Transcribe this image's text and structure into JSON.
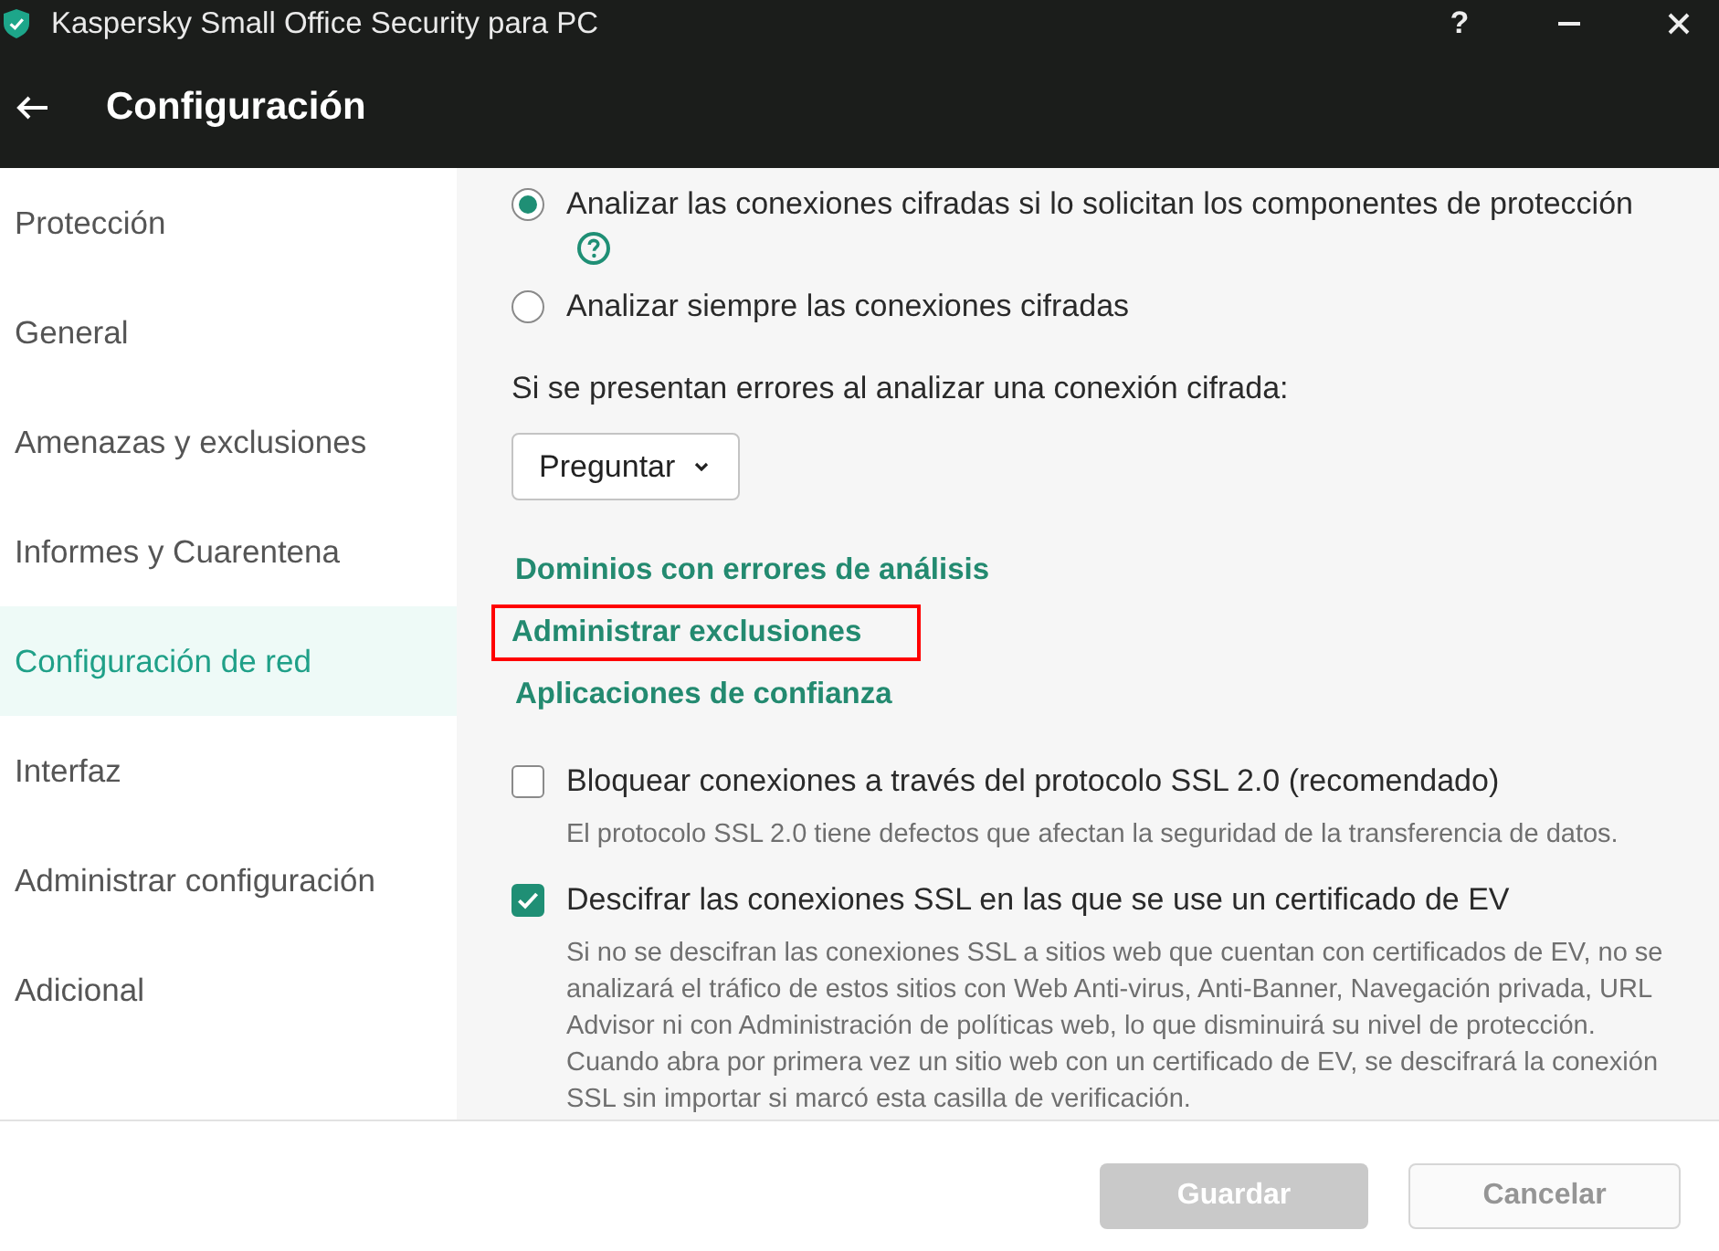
{
  "window": {
    "title": "Kaspersky Small Office Security para PC",
    "help_button": "?"
  },
  "header": {
    "title": "Configuración"
  },
  "sidebar": {
    "items": [
      {
        "label": "Protección",
        "selected": false
      },
      {
        "label": "General",
        "selected": false
      },
      {
        "label": "Amenazas y exclusiones",
        "selected": false
      },
      {
        "label": "Informes y Cuarentena",
        "selected": false
      },
      {
        "label": "Configuración de red",
        "selected": true
      },
      {
        "label": "Interfaz",
        "selected": false
      },
      {
        "label": "Administrar configuración",
        "selected": false
      },
      {
        "label": "Adicional",
        "selected": false
      }
    ]
  },
  "content": {
    "radios": [
      {
        "label": "Analizar las conexiones cifradas si lo solicitan los componentes de protección",
        "selected": true,
        "help": true
      },
      {
        "label": "Analizar siempre las conexiones cifradas",
        "selected": false,
        "help": false
      }
    ],
    "error_prompt": {
      "label": "Si se presentan errores al analizar una conexión cifrada:",
      "dropdown": {
        "value": "Preguntar"
      }
    },
    "links": [
      {
        "label": "Dominios con errores de análisis",
        "highlighted": false
      },
      {
        "label": "Administrar exclusiones",
        "highlighted": true
      },
      {
        "label": "Aplicaciones de confianza",
        "highlighted": false
      }
    ],
    "checkboxes": [
      {
        "label": "Bloquear conexiones a través del protocolo SSL 2.0 (recomendado)",
        "checked": false,
        "description": "El protocolo SSL 2.0 tiene defectos que afectan la seguridad de la transferencia de datos."
      },
      {
        "label": "Descifrar las conexiones SSL en las que se use un certificado de EV",
        "checked": true,
        "description": "Si no se descifran las conexiones SSL a sitios web que cuentan con certificados de EV, no se analizará el tráfico de estos sitios con Web Anti-virus, Anti-Banner, Navegación privada, URL Advisor ni con Administración de políticas web, lo que disminuirá su nivel de protección. Cuando abra por primera vez un sitio web con un certificado de EV, se descifrará la conexión SSL sin importar si marcó esta casilla de verificación."
      }
    ]
  },
  "footer": {
    "buttons": [
      {
        "label": "Guardar",
        "kind": "primary",
        "disabled": true
      },
      {
        "label": "Cancelar",
        "kind": "secondary",
        "disabled": true
      }
    ]
  }
}
